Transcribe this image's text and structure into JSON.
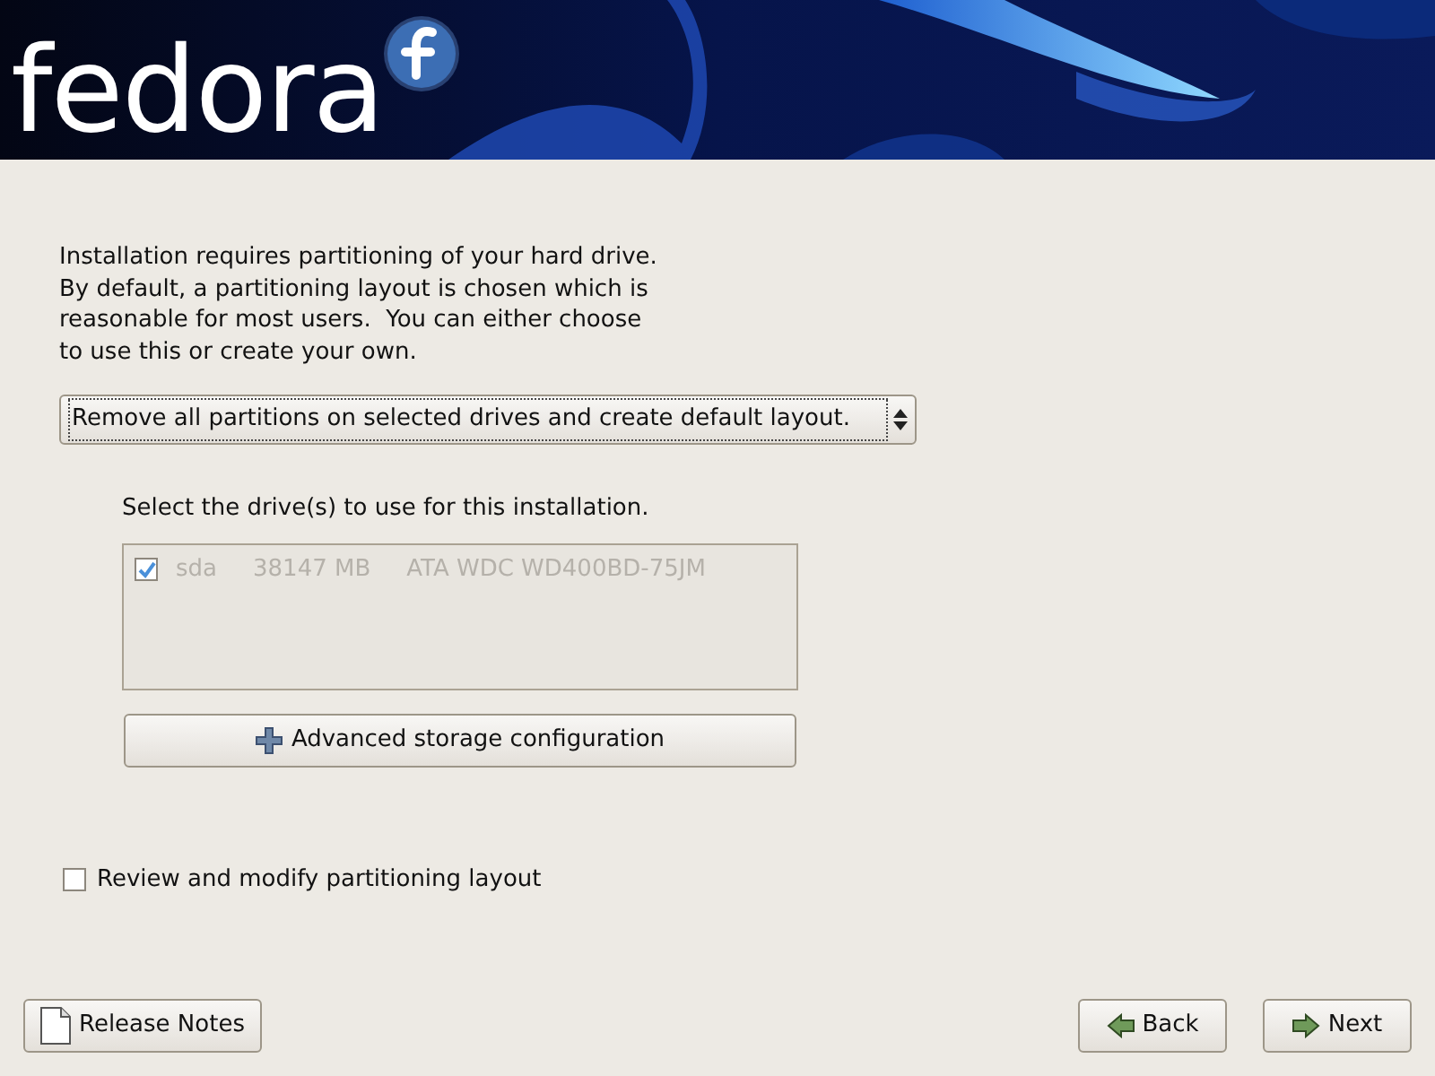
{
  "header": {
    "logo": "fedora"
  },
  "intro": "Installation requires partitioning of your hard drive.\nBy default, a partitioning layout is chosen which is\nreasonable for most users.  You can either choose\nto use this or create your own.",
  "layout_select": {
    "value": "Remove all partitions on selected drives and create default layout."
  },
  "drives": {
    "label": "Select the drive(s) to use for this installation.",
    "disabled": true,
    "rows": [
      {
        "checked": true,
        "cells": [
          "sda",
          "38147 MB",
          "ATA WDC WD400BD-75JM"
        ]
      }
    ]
  },
  "advanced_button": "Advanced storage configuration",
  "review": {
    "label": "Review and modify partitioning layout",
    "checked": false
  },
  "buttons": [
    {
      "kind": "notes",
      "label": "Release Notes"
    },
    {
      "kind": "back",
      "label": "Back"
    },
    {
      "kind": "next",
      "label": "Next"
    }
  ]
}
